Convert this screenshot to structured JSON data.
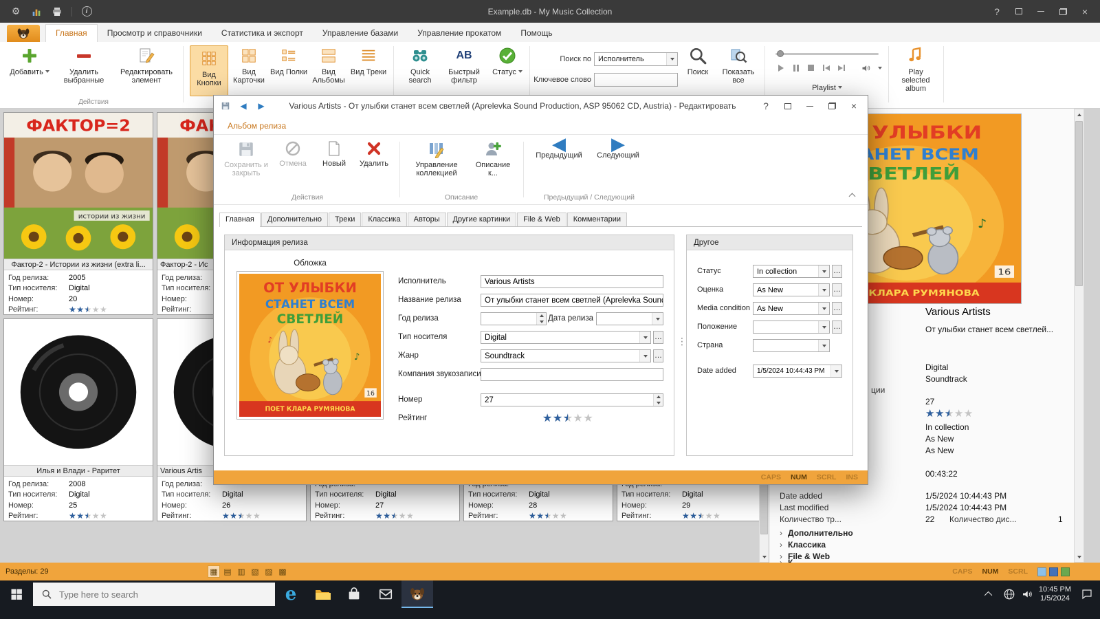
{
  "window": {
    "title": "Example.db - My Music Collection"
  },
  "ribbon_tabs": [
    "Главная",
    "Просмотр и справочники",
    "Статистика и экспорт",
    "Управление базами",
    "Управление прокатом",
    "Помощь"
  ],
  "ribbon": {
    "add": "Добавить",
    "delete_selected": "Удалить выбранные",
    "edit_item": "Редактировать элемент",
    "group_actions": "Действия",
    "views": [
      {
        "label": "Вид Кнопки"
      },
      {
        "label": "Вид Карточки"
      },
      {
        "label": "Вид Полки"
      },
      {
        "label": "Вид Альбомы"
      },
      {
        "label": "Вид Треки"
      }
    ],
    "quick_search": "Quick search",
    "quick_filter": "Быстрый фильтр",
    "quick_filter_icon": "AB",
    "status": "Статус",
    "search_by_label": "Поиск по",
    "search_by_value": "Исполнитель",
    "keyword_label": "Ключевое слово",
    "keyword_value": "",
    "search": "Поиск",
    "show_all": "Показать все",
    "playlist": "Playlist",
    "play_selected": "Play selected album"
  },
  "card_labels": {
    "year": "Год релиза:",
    "media": "Тип носителя:",
    "number": "Номер:",
    "rating": "Рейтинг:"
  },
  "cards": [
    {
      "title": "Фактор-2 - Истории из жизни (extra li...",
      "year": "2005",
      "media": "Digital",
      "number": "20",
      "rating": 2.5
    },
    {
      "title": "Фактор-2 - Ис",
      "year": "",
      "media": "",
      "number": "",
      "rating": 0
    },
    {
      "title": "Илья и Влади - Раритет",
      "year": "2008",
      "media": "Digital",
      "number": "25",
      "rating": 2.5
    },
    {
      "title": "Various Artis",
      "year": "",
      "media": "Digital",
      "number": "26",
      "rating": 2.5
    },
    {
      "title": "",
      "year": "",
      "media": "Digital",
      "number": "27",
      "rating": 2.5
    },
    {
      "title": "",
      "year": "",
      "media": "Digital",
      "number": "28",
      "rating": 2.5
    },
    {
      "title": "",
      "year": "",
      "media": "Digital",
      "number": "29",
      "rating": 2.5
    }
  ],
  "details": {
    "artist": "Various Artists",
    "album": "От улыбки станет всем светлей...",
    "media": "Digital",
    "genre": "Soundtrack",
    "number": "27",
    "rating": 2.5,
    "status": "In collection",
    "condition1": "As New",
    "condition2": "As New",
    "label_fragment": "ции",
    "duration": "00:43:22",
    "date_added_label": "Date added",
    "date_added": "1/5/2024 10:44:43 PM",
    "last_modified_label": "Last modified",
    "last_modified": "1/5/2024 10:44:43 PM",
    "tracks_label": "Количество тр...",
    "tracks": "22",
    "discs_label": "Количество дис...",
    "discs": "1",
    "tree": [
      "Дополнительно",
      "Классика",
      "File & Web",
      "К"
    ]
  },
  "dialog": {
    "title": "Various Artists - От улыбки станет всем светлей (Aprelevka Sound Production, ASP 95062 CD, Austria) - Редактировать",
    "ribbon_tab": "Альбом релиза",
    "save_close": "Сохранить и закрыть",
    "cancel": "Отмена",
    "new": "Новый",
    "delete": "Удалить",
    "manage_collection": "Управление коллекцией",
    "description": "Описание к...",
    "previous": "Предыдущий",
    "next": "Следующий",
    "group_actions": "Действия",
    "group_description": "Описание",
    "group_prevnext": "Предыдущий / Следующий",
    "tabs": [
      "Главная",
      "Дополнительно",
      "Треки",
      "Классика",
      "Авторы",
      "Другие картинки",
      "File & Web",
      "Комментарии"
    ],
    "group_info": "Информация релиза",
    "cover_label": "Обложка",
    "artist_label": "Исполнитель",
    "artist": "Various Artists",
    "title_label": "Название релиза",
    "release_title": "От улыбки станет всем светлей (Aprelevka Sound Pro",
    "year_label": "Год релиза",
    "year": "",
    "date_label": "Дата релиза",
    "date": "",
    "media_label": "Тип носителя",
    "media": "Digital",
    "genre_label": "Жанр",
    "genre": "Soundtrack",
    "company_label": "Компания звукозаписи",
    "company": "",
    "number_label": "Номер",
    "number": "27",
    "rating_label": "Рейтинг",
    "rating": 2.5,
    "group_other": "Другое",
    "status_label": "Статус",
    "status": "In collection",
    "grade_label": "Оценка",
    "grade": "As New",
    "mc_label": "Media condition",
    "mc": "As New",
    "location_label": "Положение",
    "location": "",
    "country_label": "Страна",
    "country": "",
    "added_label": "Date added",
    "added": "1/5/2024 10:44:43 PM",
    "keys": [
      "CAPS",
      "NUM",
      "SCRL",
      "INS"
    ]
  },
  "statusbar": {
    "left": "Разделы: 29",
    "keys": [
      "CAPS",
      "NUM",
      "SCRL"
    ]
  },
  "taskbar": {
    "search_placeholder": "Type here to search",
    "time": "10:45 PM",
    "date": "1/5/2024"
  },
  "art": {
    "ulybki": {
      "l1": "ОТ УЛЫБКИ",
      "l2": "СТАНЕТ ВСЕМ",
      "l3": "СВЕТЛЕЙ",
      "footer": "ПОЕТ КЛАРА РУМЯНОВА",
      "num": "16"
    },
    "faktor": {
      "title": "ФАКТОР=2",
      "subtitle": "истории из жизни"
    }
  }
}
